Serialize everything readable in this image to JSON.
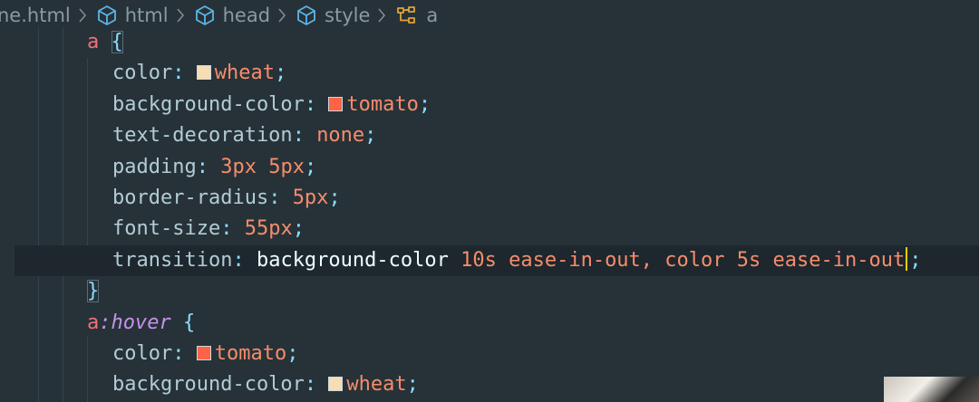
{
  "breadcrumb": {
    "items": [
      {
        "label": "ne.html",
        "icon": "none"
      },
      {
        "label": "html",
        "icon": "cube-icon"
      },
      {
        "label": "head",
        "icon": "cube-icon"
      },
      {
        "label": "style",
        "icon": "cube-icon"
      },
      {
        "label": "a",
        "icon": "css-selector-icon"
      }
    ],
    "separator": ">"
  },
  "code": {
    "lines": [
      {
        "selector": "a",
        "brace": "{"
      },
      {
        "prop": "color",
        "swatch": "#f5deb3",
        "value": "wheat"
      },
      {
        "prop": "background-color",
        "swatch": "#ff6347",
        "value": "tomato"
      },
      {
        "prop": "text-decoration",
        "value": "none"
      },
      {
        "prop": "padding",
        "value": "3px 5px"
      },
      {
        "prop": "border-radius",
        "value": "5px"
      },
      {
        "prop": "font-size",
        "value": "55px"
      },
      {
        "prop": "transition",
        "value_parts": [
          "background-color",
          "10s ease-in-out,",
          "color 5s ease-in-out",
          ";"
        ]
      },
      {
        "brace": "}"
      },
      {
        "selector": "a",
        "pseudo": ":hover",
        "brace": "{"
      },
      {
        "prop": "color",
        "swatch": "#ff6347",
        "value": "tomato"
      },
      {
        "prop": "background-color",
        "swatch": "#f5deb3",
        "value": "wheat"
      }
    ],
    "colon": ":",
    "semicolon": ";"
  },
  "colors": {
    "background": "#263238",
    "current_line": "#1d272d",
    "cursor": "#ffcc00",
    "selector": "#f07178",
    "property": "#b2ccd6",
    "value": "#f78c6c",
    "pseudo": "#c792ea"
  }
}
